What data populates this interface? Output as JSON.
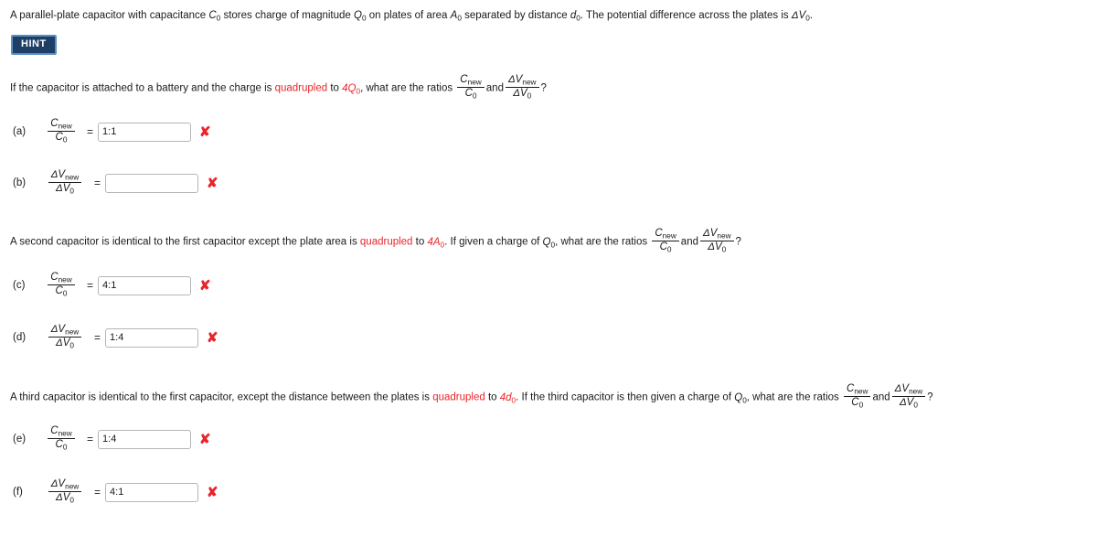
{
  "intro": {
    "text_part_1": "A parallel-plate capacitor with capacitance ",
    "sym_c0": "C",
    "sub_0": "0",
    "text_part_2": " stores charge of magnitude ",
    "sym_q0": "Q",
    "text_part_3": " on plates of area ",
    "sym_a0": "A",
    "text_part_4": " separated by distance ",
    "sym_d0": "d",
    "text_part_5": ". The potential difference across the plates is ",
    "sym_dv0": "ΔV",
    "text_part_6": "."
  },
  "hint": {
    "label": "HINT"
  },
  "question_1": {
    "text_part_1": "If the capacitor is attached to a battery and the charge is ",
    "highlight": "quadrupled",
    "text_part_2": " to ",
    "changed_quantity": "4Q",
    "sub_0": "0",
    "text_part_3": ", what are the ratios ",
    "and": "and",
    "question_mark": "?"
  },
  "question_2": {
    "text_part_1": "A second capacitor is identical to the first capacitor except the plate area is ",
    "highlight": "quadrupled",
    "text_part_2": " to ",
    "changed_quantity": "4A",
    "sub_0": "0",
    "text_part_3": ". If given a charge of ",
    "sym_q0": "Q",
    "text_part_4": ", what are the ratios ",
    "and": "and",
    "question_mark": "?"
  },
  "question_3": {
    "text_part_1": "A third capacitor is identical to the first capacitor, except the distance between the plates is ",
    "highlight": "quadrupled",
    "text_part_2": " to ",
    "changed_quantity": "4d",
    "sub_0": "0",
    "text_part_3": ". If the third capacitor is then given a charge of ",
    "sym_q0": "Q",
    "text_part_4": ", what are the ratios ",
    "and": "and",
    "question_mark": "?"
  },
  "ratios": {
    "capacitance": {
      "numerator_symbol": "C",
      "numerator_subscript": "new",
      "denominator_symbol": "C",
      "denominator_subscript": "0"
    },
    "voltage": {
      "numerator_symbol": "ΔV",
      "numerator_subscript": "new",
      "denominator_symbol": "ΔV",
      "denominator_subscript": "0"
    }
  },
  "answers": [
    {
      "id": "a",
      "label": "(a)",
      "ratio": "capacitance",
      "equals": "=",
      "value": "1:1",
      "placeholder": "",
      "status_icon": "✘",
      "status": "incorrect",
      "status_color": "#e8252a"
    },
    {
      "id": "b",
      "label": "(b)",
      "ratio": "voltage",
      "equals": "=",
      "value": "",
      "placeholder": "",
      "status_icon": "✘",
      "status": "incorrect",
      "status_color": "#e8252a"
    },
    {
      "id": "c",
      "label": "(c)",
      "ratio": "capacitance",
      "equals": "=",
      "value": "4:1",
      "placeholder": "",
      "status_icon": "✘",
      "status": "incorrect",
      "status_color": "#e8252a"
    },
    {
      "id": "d",
      "label": "(d)",
      "ratio": "voltage",
      "equals": "=",
      "value": "1:4",
      "placeholder": "",
      "status_icon": "✘",
      "status": "incorrect",
      "status_color": "#e8252a"
    },
    {
      "id": "e",
      "label": "(e)",
      "ratio": "capacitance",
      "equals": "=",
      "value": "1:4",
      "placeholder": "",
      "status_icon": "✘",
      "status": "incorrect",
      "status_color": "#e8252a"
    },
    {
      "id": "f",
      "label": "(f)",
      "ratio": "voltage",
      "equals": "=",
      "value": "4:1",
      "placeholder": "",
      "status_icon": "✘",
      "status": "incorrect",
      "status_color": "#e8252a"
    }
  ],
  "colors": {
    "text": "#1a1a1a",
    "highlight": "#e8252a",
    "hint_background": "#1d3f66",
    "hint_border": "#5a8fc4",
    "input_border": "#b5b5b5"
  }
}
